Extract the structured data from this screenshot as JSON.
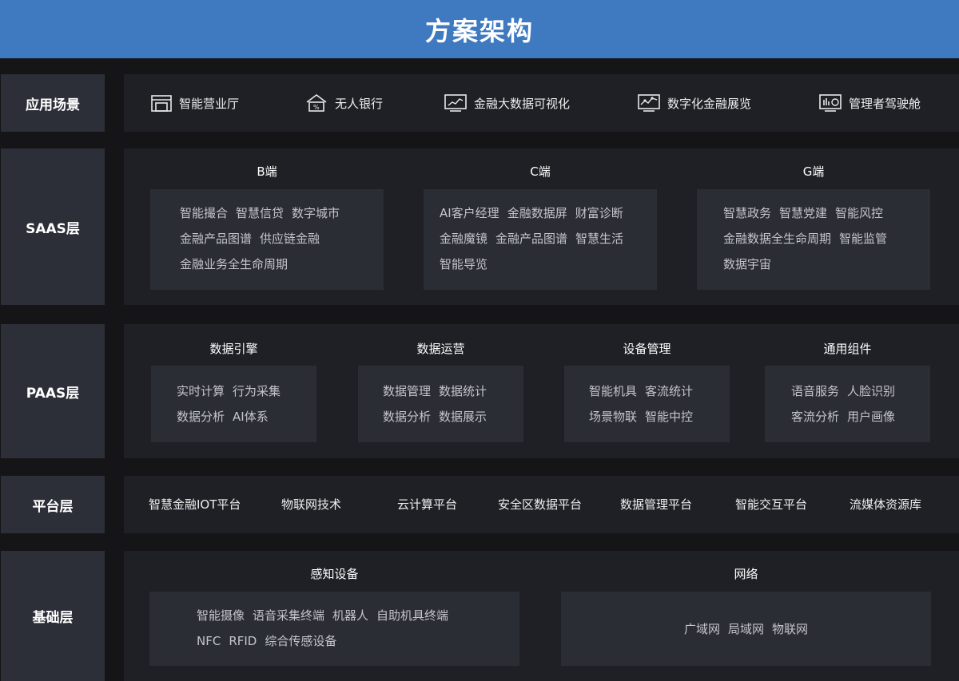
{
  "header": {
    "title": "方案架构"
  },
  "layers": {
    "app": {
      "label": "应用场景",
      "items": [
        {
          "label": "智能营业厅",
          "icon": "storefront-icon"
        },
        {
          "label": "无人银行",
          "icon": "bank-house-icon"
        },
        {
          "label": "金融大数据可视化",
          "icon": "chart-monitor-icon"
        },
        {
          "label": "数字化金融展览",
          "icon": "screen-graph-icon"
        },
        {
          "label": "管理者驾驶舱",
          "icon": "dashboard-icon"
        }
      ]
    },
    "saas": {
      "label": "SAAS层",
      "groups": [
        {
          "title": "B端",
          "lines": [
            [
              "智能撮合",
              "智慧信贷",
              "数字城市"
            ],
            [
              "金融产品图谱",
              "供应链金融"
            ],
            [
              "金融业务全生命周期"
            ]
          ]
        },
        {
          "title": "C端",
          "lines": [
            [
              "AI客户经理",
              "金融数据屏",
              "财富诊断"
            ],
            [
              "金融魔镜",
              "金融产品图谱",
              "智慧生活"
            ],
            [
              "智能导览"
            ]
          ]
        },
        {
          "title": "G端",
          "lines": [
            [
              "智慧政务",
              "智慧党建",
              "智能风控"
            ],
            [
              "金融数据全生命周期",
              "智能监管"
            ],
            [
              "数据宇宙"
            ]
          ]
        }
      ]
    },
    "paas": {
      "label": "PAAS层",
      "groups": [
        {
          "title": "数据引擎",
          "lines": [
            [
              "实时计算",
              "行为采集"
            ],
            [
              "数据分析",
              "AI体系"
            ]
          ]
        },
        {
          "title": "数据运营",
          "lines": [
            [
              "数据管理",
              "数据统计"
            ],
            [
              "数据分析",
              "数据展示"
            ]
          ]
        },
        {
          "title": "设备管理",
          "lines": [
            [
              "智能机具",
              "客流统计"
            ],
            [
              "场景物联",
              "智能中控"
            ]
          ]
        },
        {
          "title": "通用组件",
          "lines": [
            [
              "语音服务",
              "人脸识别"
            ],
            [
              "客流分析",
              "用户画像"
            ]
          ]
        }
      ]
    },
    "platform": {
      "label": "平台层",
      "items": [
        "智慧金融IOT平台",
        "物联网技术",
        "云计算平台",
        "安全区数据平台",
        "数据管理平台",
        "智能交互平台",
        "流媒体资源库"
      ]
    },
    "base": {
      "label": "基础层",
      "groups": [
        {
          "title": "感知设备",
          "lines": [
            [
              "智能摄像",
              "语音采集终端",
              "机器人",
              "自助机具终端"
            ],
            [
              "NFC",
              "RFID",
              "综合传感设备"
            ]
          ]
        },
        {
          "title": "网络",
          "lines": [
            [
              "广域网",
              "局域网",
              "物联网"
            ]
          ]
        }
      ]
    }
  }
}
